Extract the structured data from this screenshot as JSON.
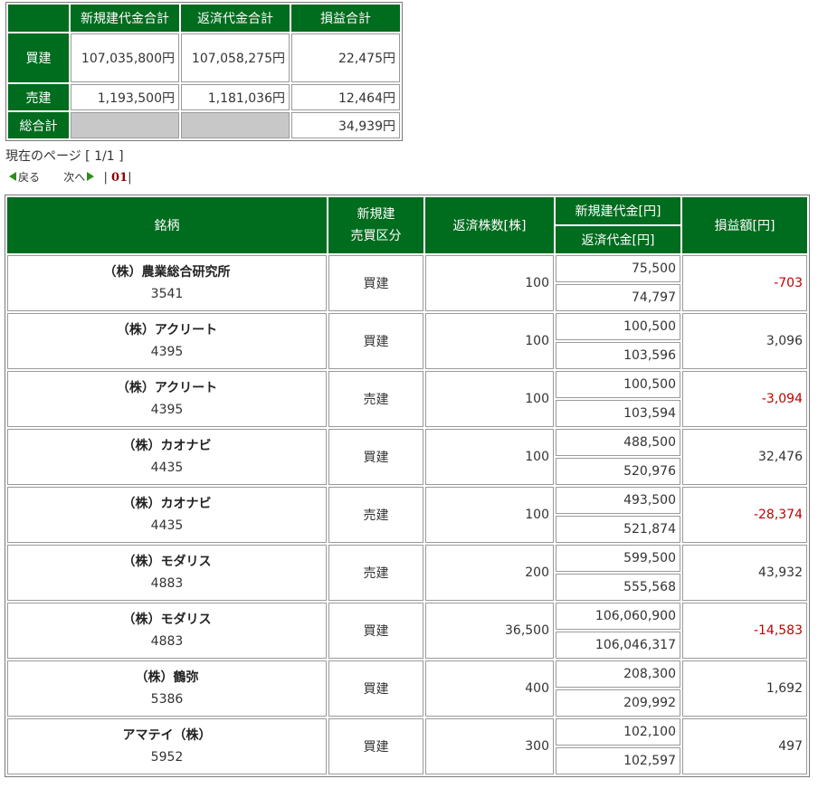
{
  "summary": {
    "headers": [
      "新規建代金合計",
      "返済代金合計",
      "損益合計"
    ],
    "rows": [
      {
        "label": "買建",
        "new_total": "107,035,800円",
        "repay_total": "107,058,275円",
        "pl_total": "22,475円"
      },
      {
        "label": "売建",
        "new_total": "1,193,500円",
        "repay_total": "1,181,036円",
        "pl_total": "12,464円"
      },
      {
        "label": "総合計",
        "new_total": "",
        "repay_total": "",
        "pl_total": "34,939円"
      }
    ]
  },
  "paging": {
    "current_label": "現在のページ [ 1/1 ]",
    "back_label": "戻る",
    "next_label": "次へ",
    "separator": "|",
    "page": "01"
  },
  "table": {
    "headers": {
      "name": "銘柄",
      "side_line1": "新規建",
      "side_line2": "売買区分",
      "qty": "返済株数[株]",
      "new_amount": "新規建代金[円]",
      "repay_amount": "返済代金[円]",
      "pl": "損益額[円]"
    },
    "rows": [
      {
        "name": "（株）農業総合研究所",
        "code": "3541",
        "side": "買建",
        "qty": "100",
        "new_amount": "75,500",
        "repay_amount": "74,797",
        "pl": "-703",
        "negative": true
      },
      {
        "name": "（株）アクリート",
        "code": "4395",
        "side": "買建",
        "qty": "100",
        "new_amount": "100,500",
        "repay_amount": "103,596",
        "pl": "3,096",
        "negative": false
      },
      {
        "name": "（株）アクリート",
        "code": "4395",
        "side": "売建",
        "qty": "100",
        "new_amount": "100,500",
        "repay_amount": "103,594",
        "pl": "-3,094",
        "negative": true
      },
      {
        "name": "（株）カオナビ",
        "code": "4435",
        "side": "買建",
        "qty": "100",
        "new_amount": "488,500",
        "repay_amount": "520,976",
        "pl": "32,476",
        "negative": false
      },
      {
        "name": "（株）カオナビ",
        "code": "4435",
        "side": "売建",
        "qty": "100",
        "new_amount": "493,500",
        "repay_amount": "521,874",
        "pl": "-28,374",
        "negative": true
      },
      {
        "name": "（株）モダリス",
        "code": "4883",
        "side": "売建",
        "qty": "200",
        "new_amount": "599,500",
        "repay_amount": "555,568",
        "pl": "43,932",
        "negative": false
      },
      {
        "name": "（株）モダリス",
        "code": "4883",
        "side": "買建",
        "qty": "36,500",
        "new_amount": "106,060,900",
        "repay_amount": "106,046,317",
        "pl": "-14,583",
        "negative": true
      },
      {
        "name": "（株）鶴弥",
        "code": "5386",
        "side": "買建",
        "qty": "400",
        "new_amount": "208,300",
        "repay_amount": "209,992",
        "pl": "1,692",
        "negative": false
      },
      {
        "name": "アマテイ（株）",
        "code": "5952",
        "side": "買建",
        "qty": "300",
        "new_amount": "102,100",
        "repay_amount": "102,597",
        "pl": "497",
        "negative": false
      }
    ]
  },
  "colors": {
    "header_green": "#006c1e",
    "negative_red": "#c00000",
    "nav_arrow": "#2f8c1e"
  }
}
